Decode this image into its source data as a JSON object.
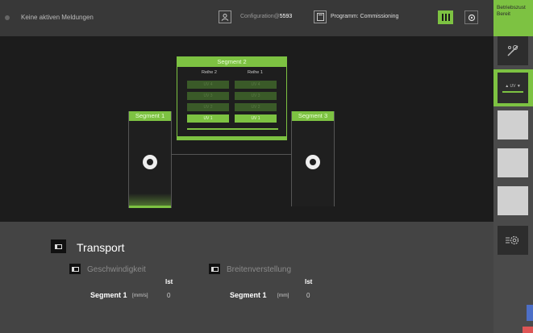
{
  "topbar": {
    "message": "Keine aktiven Meldungen",
    "config_label": "Configuration@",
    "config_number": "5593",
    "program_label": "Programm: Commissioning"
  },
  "sidebar": {
    "status_line1": "Betriebszust",
    "status_line2": "Bereit",
    "uv_label": "▲ UV ▼"
  },
  "machine": {
    "segment2": {
      "title": "Segment 2",
      "row_left": "Reihe 2",
      "row_right": "Reihe 1",
      "slots_left": [
        "UV 4",
        "UV 3",
        "UV 2",
        "UV 1"
      ],
      "slots_right": [
        "UV 4",
        "UV 3",
        "UV 2",
        "UV 1"
      ]
    },
    "segment1": {
      "title": "Segment 1"
    },
    "segment3": {
      "title": "Segment 3"
    }
  },
  "panel": {
    "title": "Transport",
    "speed": {
      "title": "Geschwindigkeit",
      "col_header": "Ist",
      "row_label": "Segment 1",
      "unit": "[mm/s]",
      "value": "0"
    },
    "width": {
      "title": "Breitenverstellung",
      "col_header": "Ist",
      "row_label": "Segment 1",
      "unit": "[mm]",
      "value": "0"
    }
  },
  "colors": {
    "accent": "#7dc242",
    "background": "#2a2a2a",
    "machine_bg": "#1c1c1c",
    "panel_bg": "#444444"
  }
}
